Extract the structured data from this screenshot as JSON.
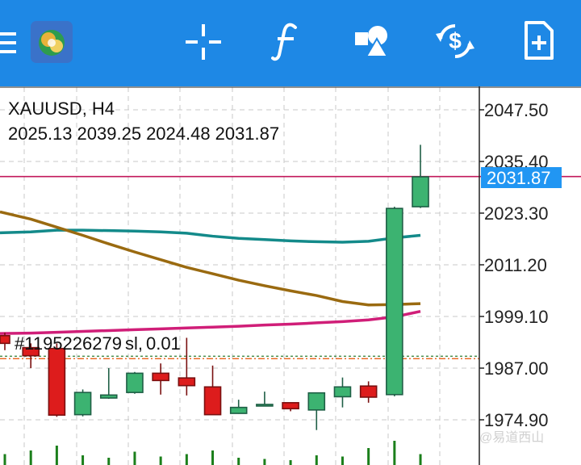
{
  "toolbar": {
    "icons": [
      "menu-icon",
      "app-logo-icon",
      "crosshair-icon",
      "indicators-icon",
      "objects-icon",
      "trade-icon",
      "new-order-icon"
    ]
  },
  "chart": {
    "symbol": "XAUUSD",
    "timeframe": "H4",
    "ohlc": [
      "2025.13",
      "2039.25",
      "2024.48",
      "2031.87"
    ],
    "current_price": "2031.87",
    "price_axis": [
      "2047.50",
      "2035.40",
      "2023.30",
      "2011.20",
      "1999.10",
      "1987.00",
      "1974.90"
    ],
    "order": {
      "ticket": "#1195226279",
      "type": "sl,",
      "volume": "0.01"
    },
    "watermark": "@易道西山",
    "colors": {
      "bull": "#3cb371",
      "bear": "#dd1c1c",
      "ma_fast": "#138a8a",
      "ma_mid": "#9a6a10",
      "ma_slow": "#d01e78",
      "bid_line": "#c2185b",
      "price_tag": "#2196f3",
      "volume": "#1b7f1b"
    }
  },
  "chart_data": {
    "type": "candlestick",
    "symbol": "XAUUSD",
    "timeframe": "H4",
    "ylim": [
      1971,
      2050
    ],
    "candles": [
      {
        "o": 1994.6,
        "h": 1995.3,
        "l": 1991.2,
        "c": 1992.8
      },
      {
        "o": 1991.8,
        "h": 1992.8,
        "l": 1987.0,
        "c": 1989.9
      },
      {
        "o": 1991.6,
        "h": 1992.8,
        "l": 1975.6,
        "c": 1976.0
      },
      {
        "o": 1976.1,
        "h": 1982.0,
        "l": 1975.7,
        "c": 1981.3
      },
      {
        "o": 1980.0,
        "h": 1987.0,
        "l": 1979.8,
        "c": 1980.7
      },
      {
        "o": 1981.3,
        "h": 1986.1,
        "l": 1981.0,
        "c": 1985.8
      },
      {
        "o": 1985.8,
        "h": 1988.1,
        "l": 1980.8,
        "c": 1984.1
      },
      {
        "o": 1984.7,
        "h": 1994.1,
        "l": 1980.6,
        "c": 1982.9
      },
      {
        "o": 1982.6,
        "h": 1987.6,
        "l": 1976.1,
        "c": 1976.1
      },
      {
        "o": 1976.4,
        "h": 1979.6,
        "l": 1976.3,
        "c": 1977.8
      },
      {
        "o": 1978.4,
        "h": 1981.5,
        "l": 1978.4,
        "c": 1978.5
      },
      {
        "o": 1978.9,
        "h": 1978.9,
        "l": 1976.9,
        "c": 1977.5
      },
      {
        "o": 1977.2,
        "h": 1981.3,
        "l": 1972.5,
        "c": 1981.2
      },
      {
        "o": 1980.3,
        "h": 1984.8,
        "l": 1977.8,
        "c": 1982.6
      },
      {
        "o": 1982.8,
        "h": 1983.9,
        "l": 1978.9,
        "c": 1980.2
      },
      {
        "o": 1980.8,
        "h": 2024.8,
        "l": 1980.4,
        "c": 2024.4
      },
      {
        "o": 2024.8,
        "h": 2039.3,
        "l": 2024.5,
        "c": 2031.8
      }
    ],
    "ma_fast": [
      2018.7,
      2018.9,
      2019.3,
      2019.3,
      2019.2,
      2019.1,
      2018.9,
      2018.6,
      2017.9,
      2017.4,
      2017.1,
      2016.8,
      2016.6,
      2016.5,
      2016.7,
      2017.5,
      2018.1
    ],
    "ma_mid": [
      2023.6,
      2021.9,
      2020.0,
      2018.1,
      2016.1,
      2014.2,
      2012.4,
      2010.6,
      2009.1,
      2007.6,
      2006.3,
      2005.1,
      2004.0,
      2002.6,
      2001.8,
      2001.9,
      2002.1
    ],
    "ma_slow": [
      1995.1,
      1995.2,
      1995.4,
      1995.6,
      1995.8,
      1996.0,
      1996.2,
      1996.4,
      1996.6,
      1996.8,
      1997.1,
      1997.3,
      1997.6,
      1997.9,
      1998.3,
      1999.0,
      2000.3
    ],
    "horizontal_lines": {
      "bid": 2031.87,
      "order_dotted": 1989.5
    },
    "volume_relative": [
      0.45,
      0.6,
      0.8,
      0.4,
      0.3,
      0.55,
      0.35,
      0.45,
      0.6,
      0.3,
      0.25,
      0.2,
      0.4,
      0.35,
      0.7,
      1.0,
      0.45
    ]
  }
}
